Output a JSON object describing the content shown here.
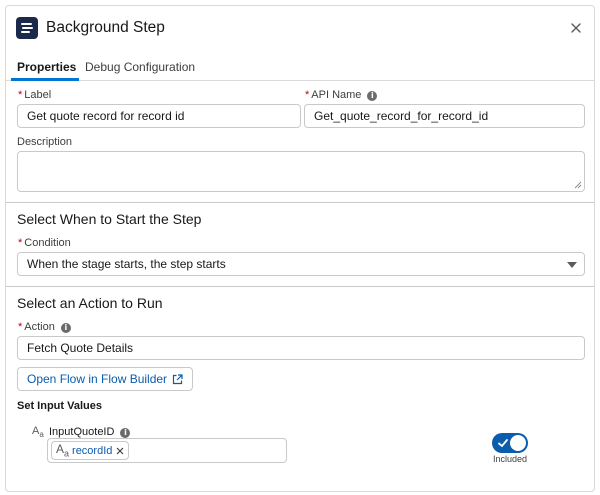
{
  "header": {
    "title": "Background Step",
    "icon": "background-step-icon",
    "close_icon": "close-icon"
  },
  "tabs": [
    {
      "label": "Properties",
      "active": true
    },
    {
      "label": "Debug Configuration",
      "active": false
    }
  ],
  "fields": {
    "label": {
      "label": "Label",
      "required": "*",
      "value": "Get quote record for record id"
    },
    "api_name": {
      "label": "API Name",
      "required": "*",
      "value": "Get_quote_record_for_record_id",
      "info_icon": "info-icon"
    },
    "description": {
      "label": "Description",
      "value": ""
    }
  },
  "start_section": {
    "title": "Select When to Start the Step",
    "condition_label": "Condition",
    "required": "*",
    "condition_value": "When the stage starts, the step starts"
  },
  "action_section": {
    "title": "Select an Action to Run",
    "action_label": "Action",
    "required": "*",
    "action_value": "Fetch Quote Details",
    "open_flow_button": "Open Flow in Flow Builder",
    "external_icon": "external-link-icon"
  },
  "input_values": {
    "title": "Set Input Values",
    "param_label": "InputQuoteID",
    "type_icon": "text-type-icon",
    "type_glyph": "A",
    "type_sub": "a",
    "pill_value": "recordId",
    "toggle_on": true,
    "toggle_label": "Included"
  },
  "colors": {
    "accent": "#0176d3",
    "link": "#0b5cab",
    "required": "#ba0517",
    "icon_bg": "#1b2a4a"
  }
}
